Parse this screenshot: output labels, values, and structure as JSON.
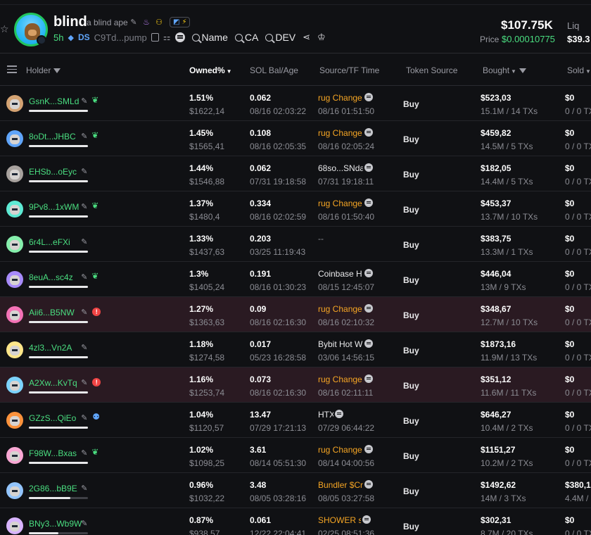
{
  "header": {
    "token_name": "blind",
    "token_subtitle": "a blind ape",
    "age": "5h",
    "ds_label": "DS",
    "ca_short": "C9Td...pump",
    "links": [
      "Name",
      "CA",
      "DEV"
    ],
    "market_cap": "$107.75K",
    "price_label": "Price",
    "price": "$0.00010775",
    "liq_label": "Liq",
    "liq_value": "$39.3"
  },
  "columns": {
    "holder": "Holder",
    "owned": "Owned%",
    "sol": "SOL Bal/Age",
    "source": "Source/TF Time",
    "token_source": "Token Source",
    "bought": "Bought",
    "sold": "Sold"
  },
  "rows": [
    {
      "addr": "GsnK...SMLd",
      "tag": "leaf",
      "bar": 1.0,
      "owned": "1.51%",
      "usd": "$1622,14",
      "sol": "0.062",
      "age": "08/16 02:03:22",
      "src": "rug Change",
      "src_color": "orange",
      "src_time": "08/16 01:51:50",
      "token_source": "Buy",
      "bought": "$523,03",
      "bought_sub": "15.1M / 14 TXs",
      "sold": "$0",
      "sold_sub": "0 / 0 TX",
      "flagged": false,
      "avatar_bg": "#d4a373"
    },
    {
      "addr": "8oDt...JHBC",
      "tag": "leaf",
      "bar": 1.0,
      "owned": "1.45%",
      "usd": "$1565,41",
      "sol": "0.108",
      "age": "08/16 02:05:35",
      "src": "rug Change",
      "src_color": "orange",
      "src_time": "08/16 02:05:24",
      "token_source": "Buy",
      "bought": "$459,82",
      "bought_sub": "14.5M / 5 TXs",
      "sold": "$0",
      "sold_sub": "0 / 0 TX",
      "flagged": false,
      "avatar_bg": "#60a5fa"
    },
    {
      "addr": "EHSb...oEyc",
      "tag": "",
      "bar": 1.0,
      "owned": "1.44%",
      "usd": "$1546,88",
      "sol": "0.062",
      "age": "07/31 19:18:58",
      "src": "68so...SNda",
      "src_color": "white",
      "src_time": "07/31 19:18:11",
      "token_source": "Buy",
      "bought": "$182,05",
      "bought_sub": "14.4M / 5 TXs",
      "sold": "$0",
      "sold_sub": "0 / 0 TX",
      "flagged": false,
      "avatar_bg": "#a8a29e"
    },
    {
      "addr": "9Pv8...1xWM",
      "tag": "leaf",
      "bar": 1.0,
      "owned": "1.37%",
      "usd": "$1480,4",
      "sol": "0.334",
      "age": "08/16 02:02:59",
      "src": "rug Change",
      "src_color": "orange",
      "src_time": "08/16 01:50:40",
      "token_source": "Buy",
      "bought": "$453,37",
      "bought_sub": "13.7M / 10 TXs",
      "sold": "$0",
      "sold_sub": "0 / 0 TX",
      "flagged": false,
      "avatar_bg": "#5eead4"
    },
    {
      "addr": "6r4L...eFXi",
      "tag": "",
      "bar": 1.0,
      "owned": "1.33%",
      "usd": "$1437,63",
      "sol": "0.203",
      "age": "03/25 11:19:43",
      "src": "--",
      "src_color": "dash",
      "src_time": "",
      "token_source": "Buy",
      "bought": "$383,75",
      "bought_sub": "13.3M / 1 TXs",
      "sold": "$0",
      "sold_sub": "0 / 0 TX",
      "flagged": false,
      "avatar_bg": "#86efac"
    },
    {
      "addr": "8euA...sc4z",
      "tag": "leaf",
      "bar": 1.0,
      "owned": "1.3%",
      "usd": "$1405,24",
      "sol": "0.191",
      "age": "08/16 01:30:23",
      "src": "Coinbase H",
      "src_color": "white",
      "src_time": "08/15 12:45:07",
      "token_source": "Buy",
      "bought": "$446,04",
      "bought_sub": "13M / 9 TXs",
      "sold": "$0",
      "sold_sub": "0 / 0 TX",
      "flagged": false,
      "avatar_bg": "#a78bfa"
    },
    {
      "addr": "Aii6...B5NW",
      "tag": "warn",
      "bar": 1.0,
      "owned": "1.27%",
      "usd": "$1363,63",
      "sol": "0.09",
      "age": "08/16 02:16:30",
      "src": "rug Change",
      "src_color": "orange",
      "src_time": "08/16 02:10:32",
      "token_source": "Buy",
      "bought": "$348,67",
      "bought_sub": "12.7M / 10 TXs",
      "sold": "$0",
      "sold_sub": "0 / 0 TX",
      "flagged": true,
      "avatar_bg": "#f472b6"
    },
    {
      "addr": "4zl3...Vn2A",
      "tag": "",
      "bar": 1.0,
      "owned": "1.18%",
      "usd": "$1274,58",
      "sol": "0.017",
      "age": "05/23 16:28:58",
      "src": "Bybit Hot W",
      "src_color": "white",
      "src_time": "03/06 14:56:15",
      "token_source": "Buy",
      "bought": "$1873,16",
      "bought_sub": "11.9M / 13 TXs",
      "sold": "$0",
      "sold_sub": "0 / 0 TX",
      "flagged": false,
      "avatar_bg": "#fde68a"
    },
    {
      "addr": "A2Xw...KvTq",
      "tag": "warn",
      "bar": 1.0,
      "owned": "1.16%",
      "usd": "$1253,74",
      "sol": "0.073",
      "age": "08/16 02:16:30",
      "src": "rug Change",
      "src_color": "orange",
      "src_time": "08/16 02:11:11",
      "token_source": "Buy",
      "bought": "$351,12",
      "bought_sub": "11.6M / 11 TXs",
      "sold": "$0",
      "sold_sub": "0 / 0 TX",
      "flagged": true,
      "avatar_bg": "#7dd3fc"
    },
    {
      "addr": "GZzS...QiEo",
      "tag": "ghost",
      "bar": 1.0,
      "owned": "1.04%",
      "usd": "$1120,57",
      "sol": "13.47",
      "age": "07/29 17:21:13",
      "src": "HTX",
      "src_color": "white",
      "src_time": "07/29 06:44:22",
      "token_source": "Buy",
      "bought": "$646,27",
      "bought_sub": "10.4M / 2 TXs",
      "sold": "$0",
      "sold_sub": "0 / 0 TX",
      "flagged": false,
      "avatar_bg": "#fb923c"
    },
    {
      "addr": "F98W...Bxas",
      "tag": "leaf",
      "bar": 1.0,
      "owned": "1.02%",
      "usd": "$1098,25",
      "sol": "3.61",
      "age": "08/14 05:51:30",
      "src": "rug Change",
      "src_color": "orange",
      "src_time": "08/14 04:00:56",
      "token_source": "Buy",
      "bought": "$1151,27",
      "bought_sub": "10.2M / 2 TXs",
      "sold": "$0",
      "sold_sub": "0 / 0 TX",
      "flagged": false,
      "avatar_bg": "#f9a8d4"
    },
    {
      "addr": "2G86...bB9E",
      "tag": "",
      "bar": 0.7,
      "owned": "0.96%",
      "usd": "$1032,22",
      "sol": "3.48",
      "age": "08/05 03:28:16",
      "src": "Bundler $Cr",
      "src_color": "orange",
      "src_time": "08/05 03:27:58",
      "token_source": "Buy",
      "bought": "$1492,62",
      "bought_sub": "14M / 3 TXs",
      "sold": "$380,1",
      "sold_sub": "4.4M /",
      "flagged": false,
      "avatar_bg": "#93c5fd"
    },
    {
      "addr": "BNy3...Wb9W",
      "tag": "",
      "bar": 0.5,
      "owned": "0.87%",
      "usd": "$938,57",
      "sol": "0.061",
      "age": "12/22 22:04:41",
      "src": "SHOWER sc",
      "src_color": "orange",
      "src_time": "02/25 08:51:36",
      "token_source": "Buy",
      "bought": "$302,31",
      "bought_sub": "8.7M / 20 TXs",
      "sold": "$0",
      "sold_sub": "0 / 0 TX",
      "flagged": false,
      "avatar_bg": "#d8b4fe"
    }
  ]
}
